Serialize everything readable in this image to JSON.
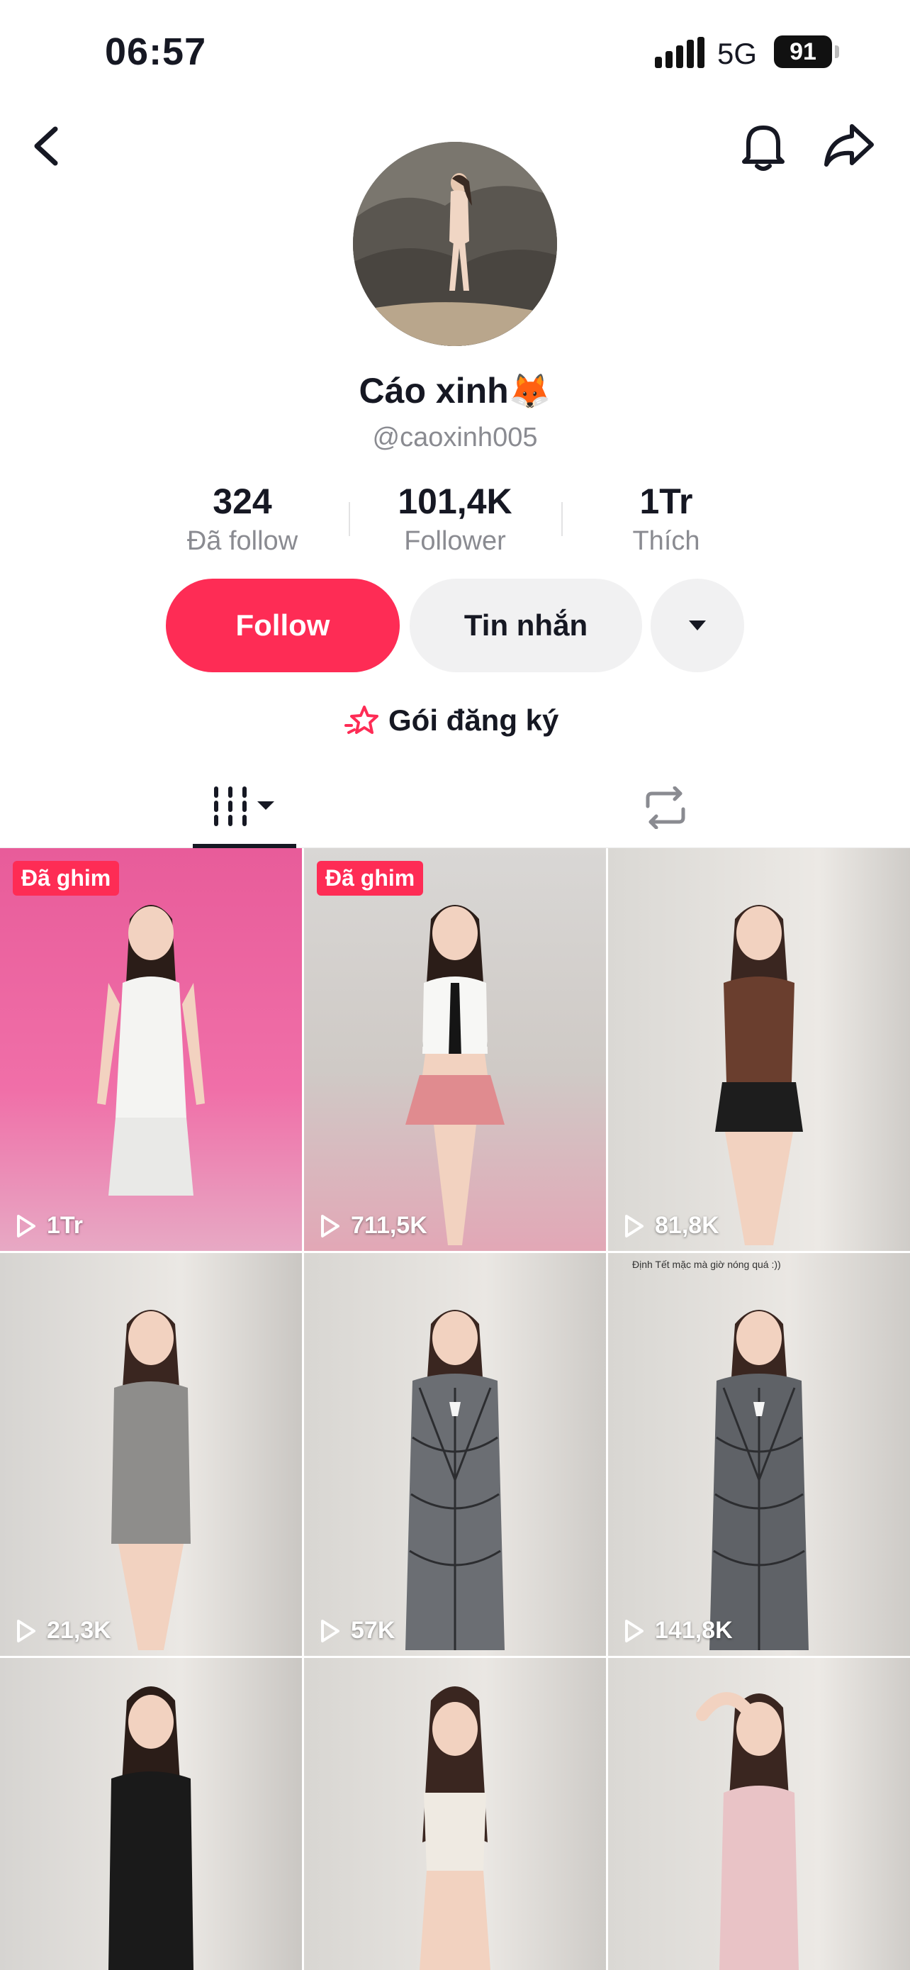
{
  "status_bar": {
    "time": "06:57",
    "network": "5G",
    "battery": "91"
  },
  "profile": {
    "display_name": "Cáo xinh",
    "display_emoji": "🦊",
    "username": "@caoxinh005"
  },
  "stats": [
    {
      "value": "324",
      "label": "Đã follow"
    },
    {
      "value": "101,4K",
      "label": "Follower"
    },
    {
      "value": "1Tr",
      "label": "Thích"
    }
  ],
  "buttons": {
    "follow": "Follow",
    "message": "Tin nhắn"
  },
  "subscription": {
    "label": "Gói đăng ký"
  },
  "colors": {
    "accent": "#fe2c55",
    "secondary_bg": "#f1f1f2"
  },
  "videos": [
    {
      "views": "1Tr",
      "pinned": "Đã ghim",
      "caption": ""
    },
    {
      "views": "711,5K",
      "pinned": "Đã ghim",
      "caption": ""
    },
    {
      "views": "81,8K",
      "pinned": "",
      "caption": ""
    },
    {
      "views": "21,3K",
      "pinned": "",
      "caption": ""
    },
    {
      "views": "57K",
      "pinned": "",
      "caption": ""
    },
    {
      "views": "141,8K",
      "pinned": "",
      "caption": "Định Tết mặc mà giờ nóng quá :))"
    },
    {
      "views": "",
      "pinned": "",
      "caption": ""
    },
    {
      "views": "",
      "pinned": "",
      "caption": ""
    },
    {
      "views": "",
      "pinned": "",
      "caption": ""
    }
  ]
}
